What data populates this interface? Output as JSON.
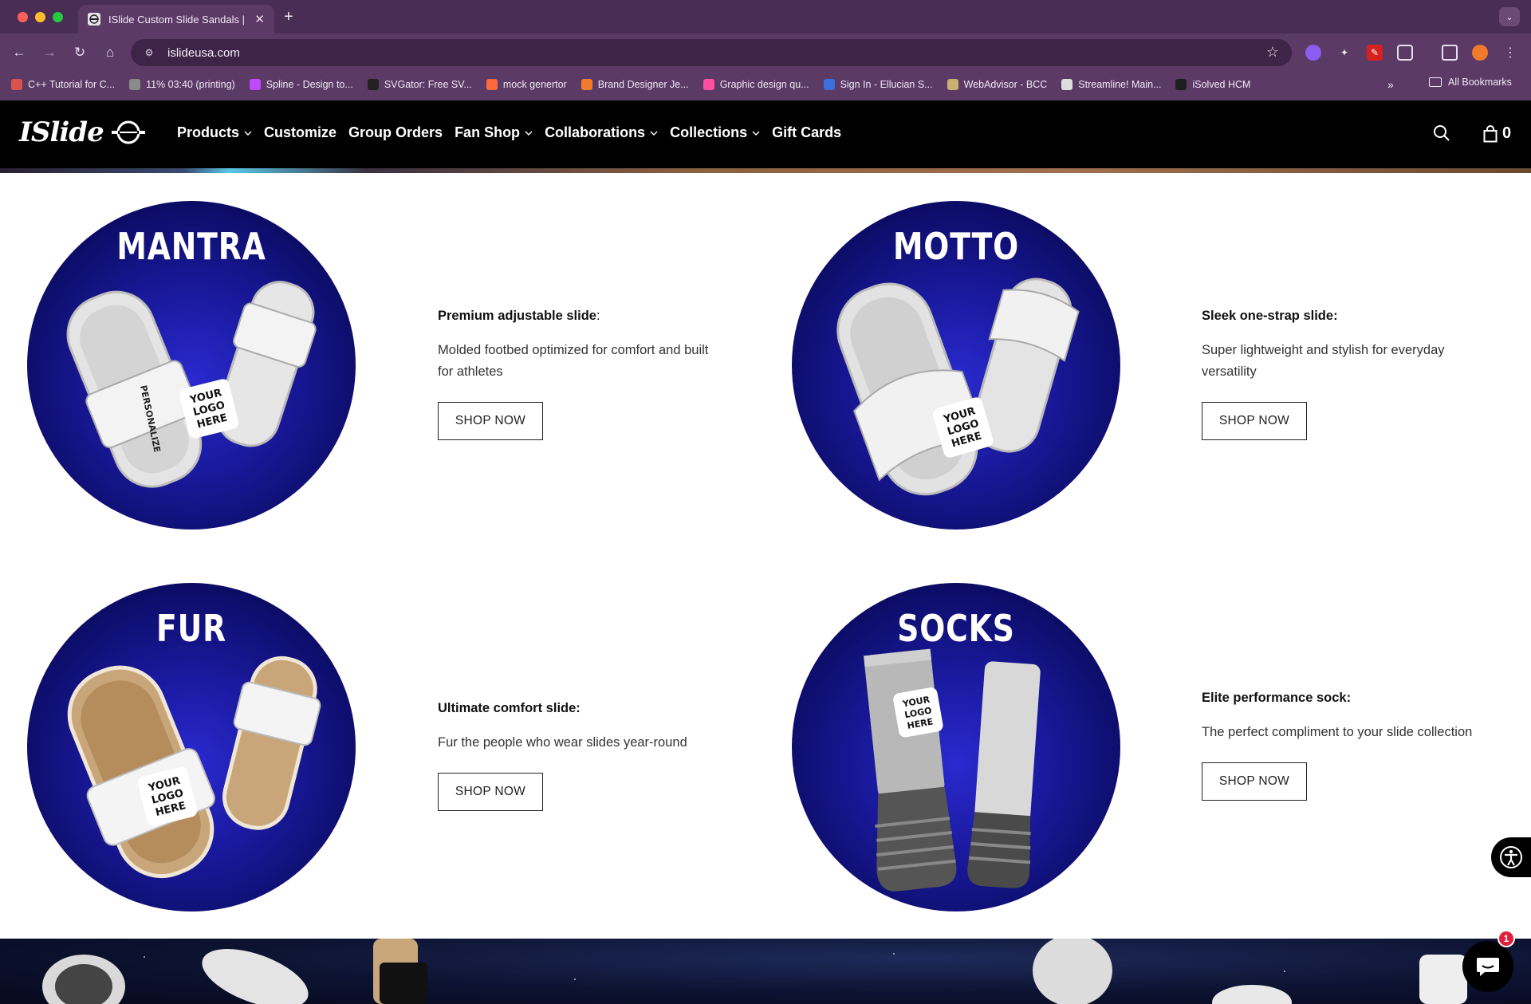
{
  "browser": {
    "tab_title": "ISlide Custom Slide Sandals |",
    "url": "islideusa.com",
    "bookmarks": [
      {
        "label": "C++ Tutorial for C...",
        "color": "#d9534f"
      },
      {
        "label": "11% 03:40 (printing)",
        "color": "#8a8a8a"
      },
      {
        "label": "Spline - Design to...",
        "color": "#c04aff"
      },
      {
        "label": "SVGator: Free SV...",
        "color": "#222222"
      },
      {
        "label": "mock genertor",
        "color": "#ff6a3d"
      },
      {
        "label": "Brand Designer Je...",
        "color": "#f07b2a"
      },
      {
        "label": "Graphic design qu...",
        "color": "#ff4fa0"
      },
      {
        "label": "Sign In - Ellucian S...",
        "color": "#3a6fe0"
      },
      {
        "label": "WebAdvisor - BCC",
        "color": "#c8b070"
      },
      {
        "label": "Streamline! Main...",
        "color": "#dddddd"
      },
      {
        "label": "iSolved HCM",
        "color": "#1e1e1e"
      }
    ],
    "more_bookmarks": "»",
    "all_bookmarks": "All Bookmarks"
  },
  "site": {
    "logo_text": "ISlide",
    "nav": [
      {
        "label": "Products",
        "dropdown": true
      },
      {
        "label": "Customize",
        "dropdown": false
      },
      {
        "label": "Group Orders",
        "dropdown": false
      },
      {
        "label": "Fan Shop",
        "dropdown": true
      },
      {
        "label": "Collaborations",
        "dropdown": true
      },
      {
        "label": "Collections",
        "dropdown": true
      },
      {
        "label": "Gift Cards",
        "dropdown": false
      }
    ],
    "cart_count": "0"
  },
  "products": [
    {
      "title": "MANTRA",
      "headline": "Premium adjustable slide",
      "headline_suffix": ":",
      "description": "Molded footbed optimized for comfort and built for athletes",
      "button": "SHOP NOW"
    },
    {
      "title": "MOTTO",
      "headline": "Sleek one-strap slide:",
      "headline_suffix": "",
      "description": "Super lightweight and stylish for everyday versatility",
      "button": "SHOP NOW"
    },
    {
      "title": "FUR",
      "headline": "Ultimate comfort slide:",
      "headline_suffix": "",
      "description": "Fur the people who wear slides year-round",
      "button": "SHOP NOW"
    },
    {
      "title": "SOCKS",
      "headline": "Elite performance sock:",
      "headline_suffix": "",
      "description": "The perfect compliment to your slide collection",
      "button": "SHOP NOW"
    }
  ],
  "art_text": {
    "logo_line1": "YOUR",
    "logo_line2": "LOGO",
    "logo_line3": "HERE",
    "personalize": "PERSONALIZE"
  },
  "chat_badge": "1",
  "colors": {
    "chrome_bg": "#5b3a66",
    "header_bg": "#000000",
    "circle_blue": "#1a1aa0"
  }
}
